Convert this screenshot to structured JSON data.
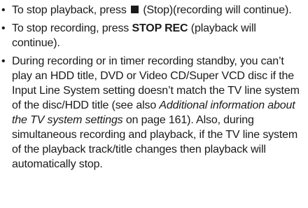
{
  "bullets": [
    {
      "before_icon": "To stop playback, press",
      "icon": "stop-square-icon",
      "after_icon": "(Stop)(recording will continue)."
    },
    {
      "before_bold": "To stop recording, press ",
      "bold": "STOP REC",
      "after_bold": " (playback will continue)."
    },
    {
      "before_italic": "During recording or in timer recording standby, you can’t play an HDD title, DVD or Video CD/Super VCD disc if the Input Line System setting doesn’t match the TV line system of the disc/HDD title (see also ",
      "italic": "Additional information about the TV system settings",
      "after_italic": " on page 161). Also, during simultaneous recording and playback, if the TV line system of the playback track/title changes then playback will automatically stop."
    }
  ]
}
